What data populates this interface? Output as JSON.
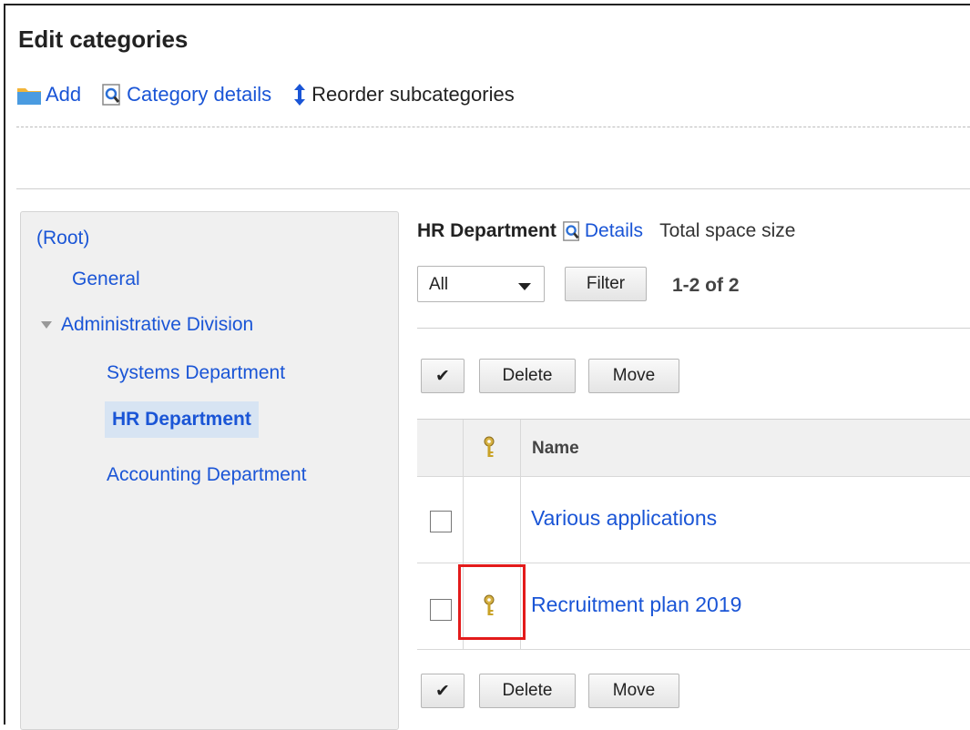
{
  "page": {
    "title": "Edit categories"
  },
  "toolbar": {
    "add_label": "Add",
    "category_details_label": "Category details",
    "reorder_label": "Reorder subcategories"
  },
  "tree": {
    "root": "(Root)",
    "general": "General",
    "admin_division": "Administrative Division",
    "systems": "Systems Department",
    "hr": "HR Department",
    "accounting": "Accounting Department"
  },
  "main": {
    "category_name": "HR Department",
    "details_label": "Details",
    "space_label": "Total space size",
    "filter_value": "All",
    "filter_button": "Filter",
    "count": "1-2 of 2",
    "check_all_symbol": "✔",
    "delete_label": "Delete",
    "move_label": "Move",
    "col_name": "Name",
    "rows": [
      {
        "name": "Various applications",
        "locked": false
      },
      {
        "name": "Recruitment plan 2019",
        "locked": true
      }
    ]
  },
  "icons": {
    "folder": "folder-icon",
    "magnifier": "document-magnifier-icon",
    "reorder": "up-down-arrow-icon",
    "key": "key-icon"
  },
  "colors": {
    "link": "#1a55d6",
    "highlight": "#e31b1b",
    "key": "#c9a227"
  }
}
